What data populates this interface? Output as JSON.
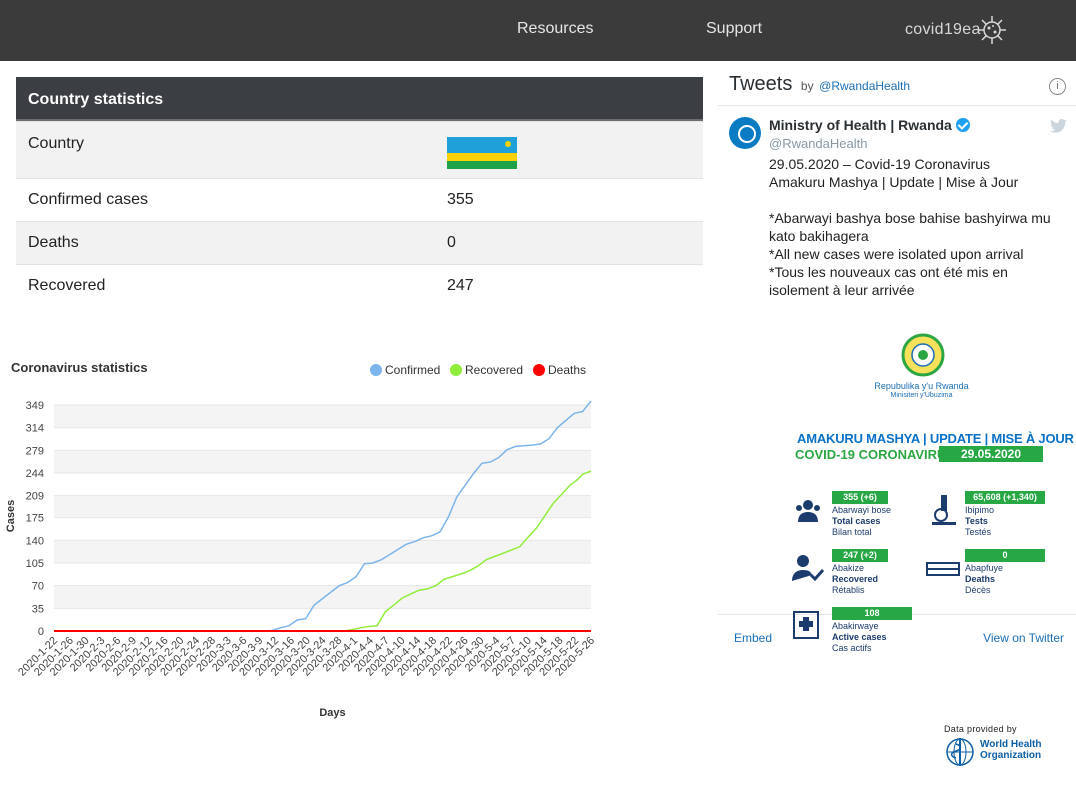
{
  "nav": {
    "links": [
      "Resources",
      "Support"
    ],
    "logo_text": "covid19ea"
  },
  "country_stats": {
    "title": "Country statistics",
    "rows": [
      {
        "label": "Country",
        "value": ""
      },
      {
        "label": "Confirmed cases",
        "value": "355"
      },
      {
        "label": "Deaths",
        "value": "0"
      },
      {
        "label": "Recovered",
        "value": "247"
      }
    ]
  },
  "colors": {
    "confirmed": "#7cb5ec",
    "recovered": "#90ed3a",
    "deaths": "#ff0000",
    "flag_blue": "#20A0D8",
    "flag_yellow": "#FAD201",
    "flag_green": "#20A24A"
  },
  "chart_data": {
    "type": "line",
    "title": "Coronavirus statistics",
    "xlabel": "Days",
    "ylabel": "Cases",
    "legend_position": "top-right",
    "grid": true,
    "ylim": [
      0,
      349
    ],
    "y_ticks": [
      0,
      35,
      70,
      105,
      140,
      175,
      209,
      244,
      279,
      314,
      349
    ],
    "x_tick_labels": [
      "2020-1-22",
      "2020-1-26",
      "2020-1-30",
      "2020-2-3",
      "2020-2-6",
      "2020-2-9",
      "2020-2-12",
      "2020-2-16",
      "2020-2-20",
      "2020-2-24",
      "2020-2-28",
      "2020-3-3",
      "2020-3-6",
      "2020-3-9",
      "2020-3-12",
      "2020-3-16",
      "2020-3-20",
      "2020-3-24",
      "2020-3-28",
      "2020-4-1",
      "2020-4-4",
      "2020-4-7",
      "2020-4-10",
      "2020-4-14",
      "2020-4-18",
      "2020-4-22",
      "2020-4-26",
      "2020-4-30",
      "2020-5-4",
      "2020-5-7",
      "2020-5-10",
      "2020-5-14",
      "2020-5-18",
      "2020-5-22",
      "2020-5-26"
    ],
    "x_start": "2020-01-22",
    "x_end": "2020-05-29",
    "series": [
      {
        "name": "Confirmed",
        "points": [
          [
            "2020-01-22",
            0
          ],
          [
            "2020-03-13",
            0
          ],
          [
            "2020-03-14",
            1
          ],
          [
            "2020-03-16",
            5
          ],
          [
            "2020-03-18",
            8
          ],
          [
            "2020-03-20",
            17
          ],
          [
            "2020-03-22",
            19
          ],
          [
            "2020-03-24",
            40
          ],
          [
            "2020-03-26",
            50
          ],
          [
            "2020-03-28",
            60
          ],
          [
            "2020-03-30",
            70
          ],
          [
            "2020-04-01",
            75
          ],
          [
            "2020-04-03",
            84
          ],
          [
            "2020-04-05",
            104
          ],
          [
            "2020-04-07",
            105
          ],
          [
            "2020-04-09",
            110
          ],
          [
            "2020-04-11",
            118
          ],
          [
            "2020-04-13",
            126
          ],
          [
            "2020-04-15",
            134
          ],
          [
            "2020-04-17",
            138
          ],
          [
            "2020-04-19",
            144
          ],
          [
            "2020-04-21",
            147
          ],
          [
            "2020-04-23",
            153
          ],
          [
            "2020-04-25",
            176
          ],
          [
            "2020-04-27",
            207
          ],
          [
            "2020-04-29",
            225
          ],
          [
            "2020-05-01",
            243
          ],
          [
            "2020-05-03",
            259
          ],
          [
            "2020-05-05",
            261
          ],
          [
            "2020-05-07",
            268
          ],
          [
            "2020-05-09",
            280
          ],
          [
            "2020-05-11",
            285
          ],
          [
            "2020-05-13",
            286
          ],
          [
            "2020-05-15",
            287
          ],
          [
            "2020-05-17",
            289
          ],
          [
            "2020-05-19",
            297
          ],
          [
            "2020-05-21",
            314
          ],
          [
            "2020-05-23",
            325
          ],
          [
            "2020-05-25",
            336
          ],
          [
            "2020-05-27",
            339
          ],
          [
            "2020-05-29",
            355
          ]
        ]
      },
      {
        "name": "Recovered",
        "points": [
          [
            "2020-01-22",
            0
          ],
          [
            "2020-03-31",
            0
          ],
          [
            "2020-04-02",
            2
          ],
          [
            "2020-04-04",
            5
          ],
          [
            "2020-04-06",
            7
          ],
          [
            "2020-04-08",
            8
          ],
          [
            "2020-04-10",
            30
          ],
          [
            "2020-04-12",
            40
          ],
          [
            "2020-04-14",
            51
          ],
          [
            "2020-04-16",
            57
          ],
          [
            "2020-04-18",
            63
          ],
          [
            "2020-04-20",
            65
          ],
          [
            "2020-04-22",
            70
          ],
          [
            "2020-04-24",
            80
          ],
          [
            "2020-04-26",
            84
          ],
          [
            "2020-04-28",
            88
          ],
          [
            "2020-04-30",
            93
          ],
          [
            "2020-05-02",
            100
          ],
          [
            "2020-05-04",
            110
          ],
          [
            "2020-05-06",
            115
          ],
          [
            "2020-05-08",
            120
          ],
          [
            "2020-05-10",
            125
          ],
          [
            "2020-05-12",
            130
          ],
          [
            "2020-05-14",
            145
          ],
          [
            "2020-05-16",
            159
          ],
          [
            "2020-05-18",
            178
          ],
          [
            "2020-05-20",
            197
          ],
          [
            "2020-05-22",
            211
          ],
          [
            "2020-05-24",
            225
          ],
          [
            "2020-05-26",
            235
          ],
          [
            "2020-05-27",
            242
          ],
          [
            "2020-05-29",
            247
          ]
        ]
      },
      {
        "name": "Deaths",
        "points": [
          [
            "2020-01-22",
            0
          ],
          [
            "2020-05-29",
            0
          ]
        ]
      }
    ]
  },
  "tweets": {
    "title": "Tweets",
    "by": "by",
    "handle_link": "@RwandaHealth",
    "info": "i",
    "author_name": "Ministry of Health | Rwanda",
    "author_handle": "@RwandaHealth",
    "text": [
      "29.05.2020 – Covid-19 Coronavirus",
      "Amakuru Mashya | Update | Mise à Jour",
      "",
      "*Abarwayi bashya bose bahise bashyirwa mu kato bakihagera",
      "*All new cases were isolated upon arrival",
      "*Tous les nouveaux cas ont été mis en isolement à leur arrivée"
    ],
    "embed": "Embed",
    "view": "View on Twitter",
    "infographic": {
      "republic": "Repubulika y'u Rwanda",
      "ministry": "Minisiteri y'Ubuzima",
      "head1": "AMAKURU MASHYA | UPDATE | MISE À JOUR",
      "head2": "COVID-19 CORONAVIRUS",
      "date": "29.05.2020",
      "blocks": [
        {
          "value": "355 (+6)",
          "lines": [
            "Abarwayi bose",
            "Total cases",
            "Bilan total"
          ]
        },
        {
          "value": "65,608 (+1,340)",
          "lines": [
            "Ibipimo",
            "Tests",
            "Testés"
          ]
        },
        {
          "value": "247 (+2)",
          "lines": [
            "Abakize",
            "Recovered",
            "Rétablis"
          ]
        },
        {
          "value": "0",
          "lines": [
            "Abapfuye",
            "Deaths",
            "Décès"
          ]
        },
        {
          "value": "108",
          "lines": [
            "Abakirwaye",
            "Active cases",
            "Cas actifs"
          ]
        }
      ]
    }
  },
  "credit": {
    "provided_by": "Data provided by",
    "org_line1": "World Health",
    "org_line2": "Organization"
  }
}
